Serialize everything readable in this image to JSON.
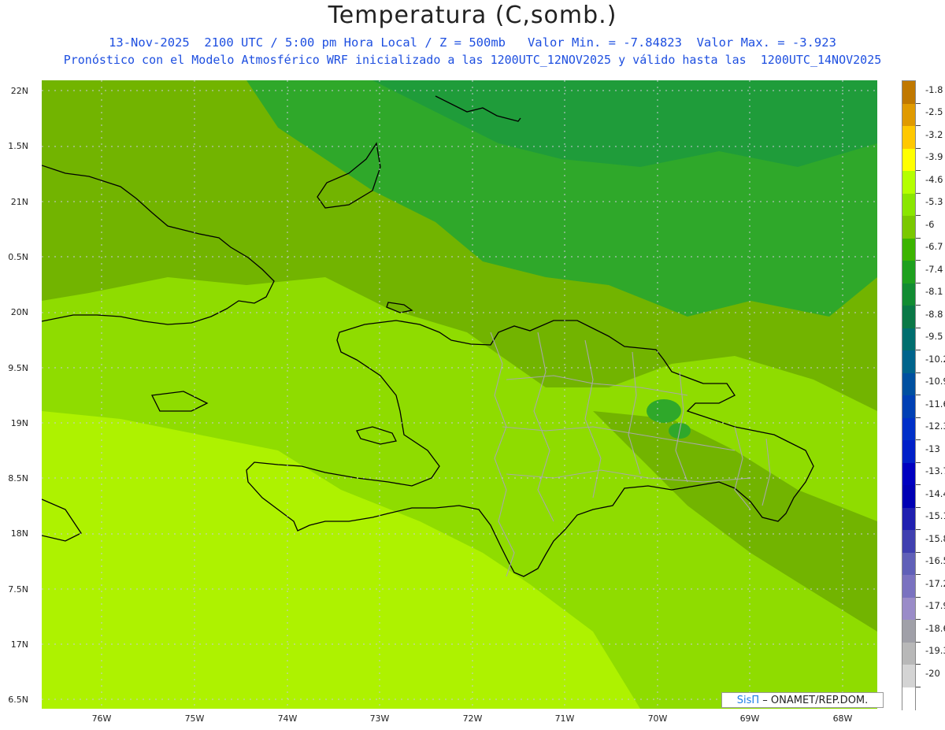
{
  "title": "Temperatura (C,somb.)",
  "subtitle_line1": "13-Nov-2025  2100 UTC / 5:00 pm Hora Local / Z = 500mb   Valor Min. = -7.84823  Valor Max. = -3.923",
  "subtitle_line2": "Pronóstico con el Modelo Atmosférico WRF inicializado a las 1200UTC_12NOV2025 y válido hasta las  1200UTC_14NOV2025",
  "lat_labels": [
    "22N",
    "1.5N",
    "21N",
    "0.5N",
    "20N",
    "9.5N",
    "19N",
    "8.5N",
    "18N",
    "7.5N",
    "17N",
    "6.5N"
  ],
  "lon_labels": [
    "76W",
    "75W",
    "74W",
    "73W",
    "72W",
    "71W",
    "70W",
    "69W",
    "68W"
  ],
  "colorbar": {
    "labels": [
      "-1.8",
      "-2.5",
      "-3.2",
      "-3.9",
      "-4.6",
      "-5.3",
      "-6",
      "-6.7",
      "-7.4",
      "-8.1",
      "-8.8",
      "-9.5",
      "-10.2",
      "-10.9",
      "-11.6",
      "-12.3",
      "-13",
      "-13.7",
      "-14.4",
      "-15.1",
      "-15.8",
      "-16.5",
      "-17.2",
      "-17.9",
      "-18.6",
      "-19.3",
      "-20"
    ],
    "colors": [
      "#c07800",
      "#e09a00",
      "#ffc800",
      "#ffff00",
      "#b4ff00",
      "#8ae600",
      "#7ac800",
      "#3cb400",
      "#1ea01e",
      "#128c32",
      "#0a7846",
      "#006e6e",
      "#00648c",
      "#0050a0",
      "#0040b4",
      "#0030c8",
      "#0020c8",
      "#0000c0",
      "#0000b4",
      "#2020b0",
      "#4040b0",
      "#6060b8",
      "#7a72c0",
      "#9a8cc8",
      "#a0a0a8",
      "#b8b8b8",
      "#d4d4d4",
      "#ffffff"
    ]
  },
  "field_colors": {
    "warm": "#aef200",
    "mid": "#8fdc00",
    "cool": "#72b400",
    "cold": "#2fa82a",
    "coldest": "#1f9c3a"
  },
  "credit": {
    "brand": "SisΠ",
    "text": " – ONAMET/REP.DOM."
  }
}
